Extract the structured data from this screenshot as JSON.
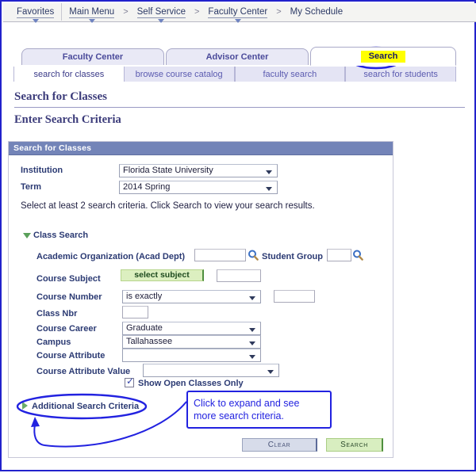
{
  "breadcrumb": {
    "items": [
      {
        "label": "Favorites",
        "has_caret": true,
        "divider": true
      },
      {
        "label": "Main Menu",
        "has_caret": true,
        "divider": false
      },
      {
        "label": "Self Service",
        "has_caret": true,
        "divider": false
      },
      {
        "label": "Faculty Center",
        "has_caret": true,
        "divider": false
      },
      {
        "label": "My Schedule",
        "has_caret": false,
        "divider": false
      }
    ],
    "separator": ">"
  },
  "tabs": [
    {
      "label": "Faculty Center",
      "active": false
    },
    {
      "label": "Advisor Center",
      "active": false
    },
    {
      "label": "Search",
      "active": true,
      "highlight": "#ffff00"
    }
  ],
  "subtabs": [
    {
      "label": "search for classes",
      "active": true
    },
    {
      "label": "browse course catalog",
      "active": false
    },
    {
      "label": "faculty search",
      "active": false
    },
    {
      "label": "search for students",
      "active": false
    }
  ],
  "headings": {
    "page_title": "Search for Classes",
    "section_title": "Enter Search Criteria"
  },
  "panel": {
    "header": "Search for Classes",
    "institution_label": "Institution",
    "institution_value": "Florida State University",
    "term_label": "Term",
    "term_value": "2014 Spring",
    "instruction": "Select at least 2 search criteria. Click Search to view your search results.",
    "class_search_label": "Class Search",
    "acad_org_label": "Academic Organization (Acad Dept)",
    "acad_org_value": "",
    "student_group_label": "Student Group",
    "student_group_value": "",
    "course_subject_label": "Course Subject",
    "select_subject_button": "select subject",
    "course_subject_value": "",
    "course_number_label": "Course Number",
    "course_number_operator": "is exactly",
    "course_number_value": "",
    "class_nbr_label": "Class Nbr",
    "class_nbr_value": "",
    "course_career_label": "Course Career",
    "course_career_value": "Graduate",
    "campus_label": "Campus",
    "campus_value": "Tallahassee",
    "course_attribute_label": "Course Attribute",
    "course_attribute_value": "",
    "course_attribute_value_label": "Course Attribute Value",
    "course_attribute_value_value": "",
    "show_open_label": "Show Open Classes Only",
    "show_open_checked": true,
    "additional_label": "Additional Search Criteria",
    "clear_button": "Clear",
    "search_button": "Search"
  },
  "annotation": {
    "callout_line1": "Click to expand and see",
    "callout_line2": "more search criteria.",
    "color": "#2222e0",
    "highlight_color": "#ffff00"
  }
}
